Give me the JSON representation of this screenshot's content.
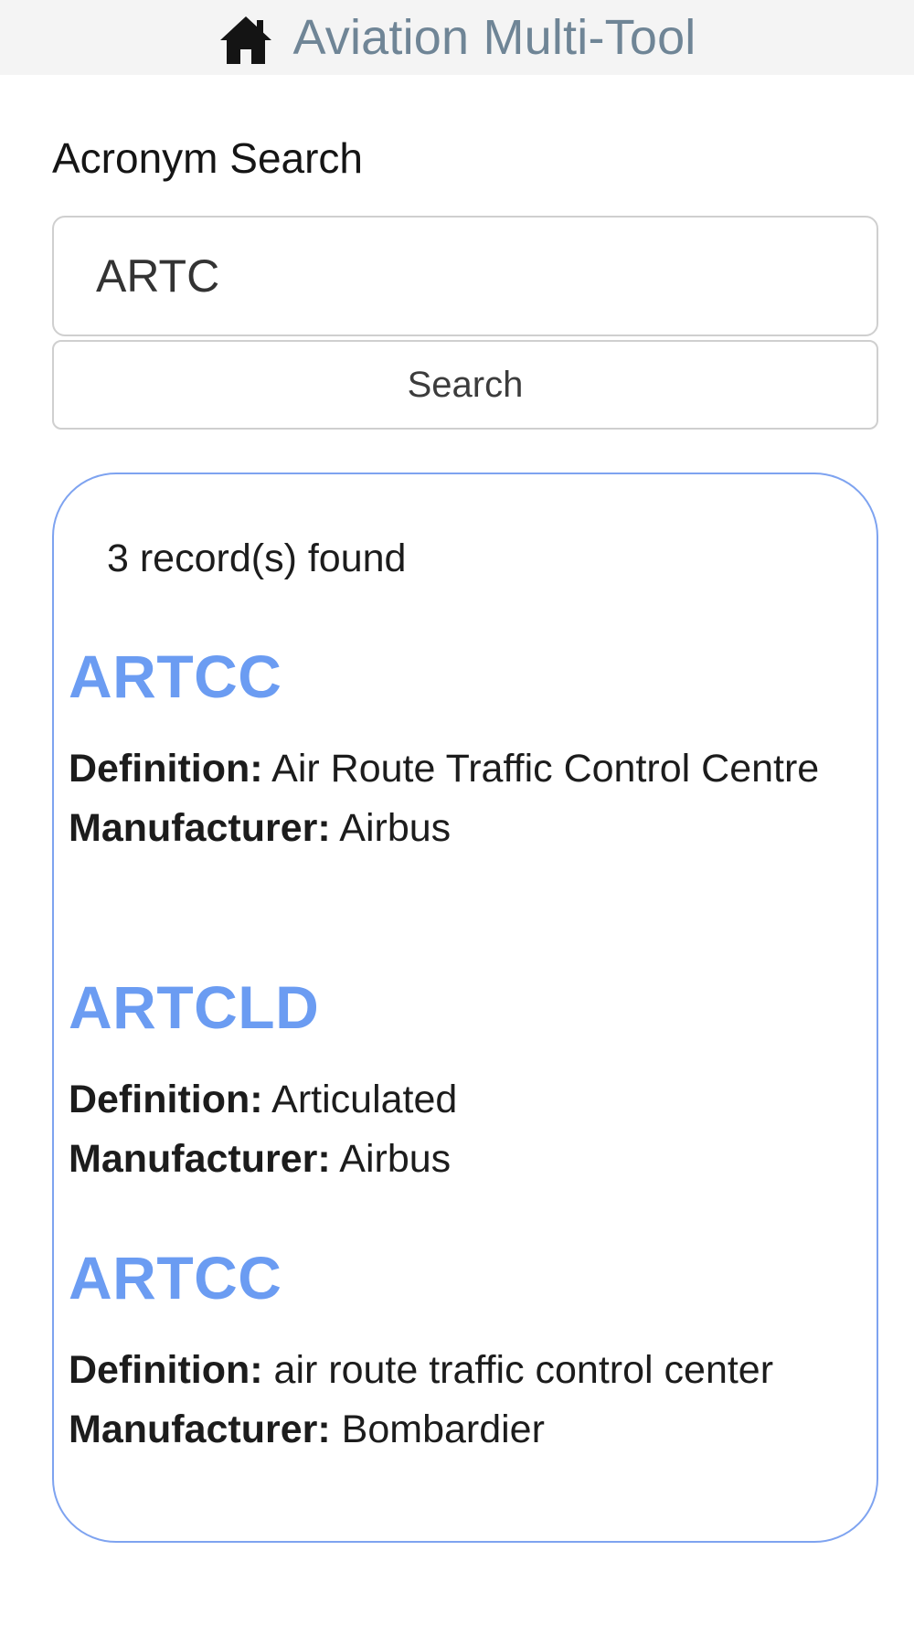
{
  "header": {
    "icon": "home-icon",
    "title": "Aviation Multi-Tool"
  },
  "search": {
    "section_title": "Acronym Search",
    "value": "ARTC",
    "button_label": "Search"
  },
  "results": {
    "count_text": "3 record(s) found",
    "definition_label": "Definition:",
    "manufacturer_label": "Manufacturer:",
    "items": [
      {
        "acronym": "ARTCC",
        "definition": "Air Route Traffic Control Centre",
        "manufacturer": "Airbus"
      },
      {
        "acronym": "ARTCLD",
        "definition": "Articulated",
        "manufacturer": "Airbus"
      },
      {
        "acronym": "ARTCC",
        "definition": "air route traffic control center",
        "manufacturer": "Bombardier"
      }
    ]
  },
  "colors": {
    "accent": "#6b9cf2",
    "card_border": "#7ea3f0",
    "header_bg": "#f4f4f4",
    "header_text": "#6f8596"
  }
}
